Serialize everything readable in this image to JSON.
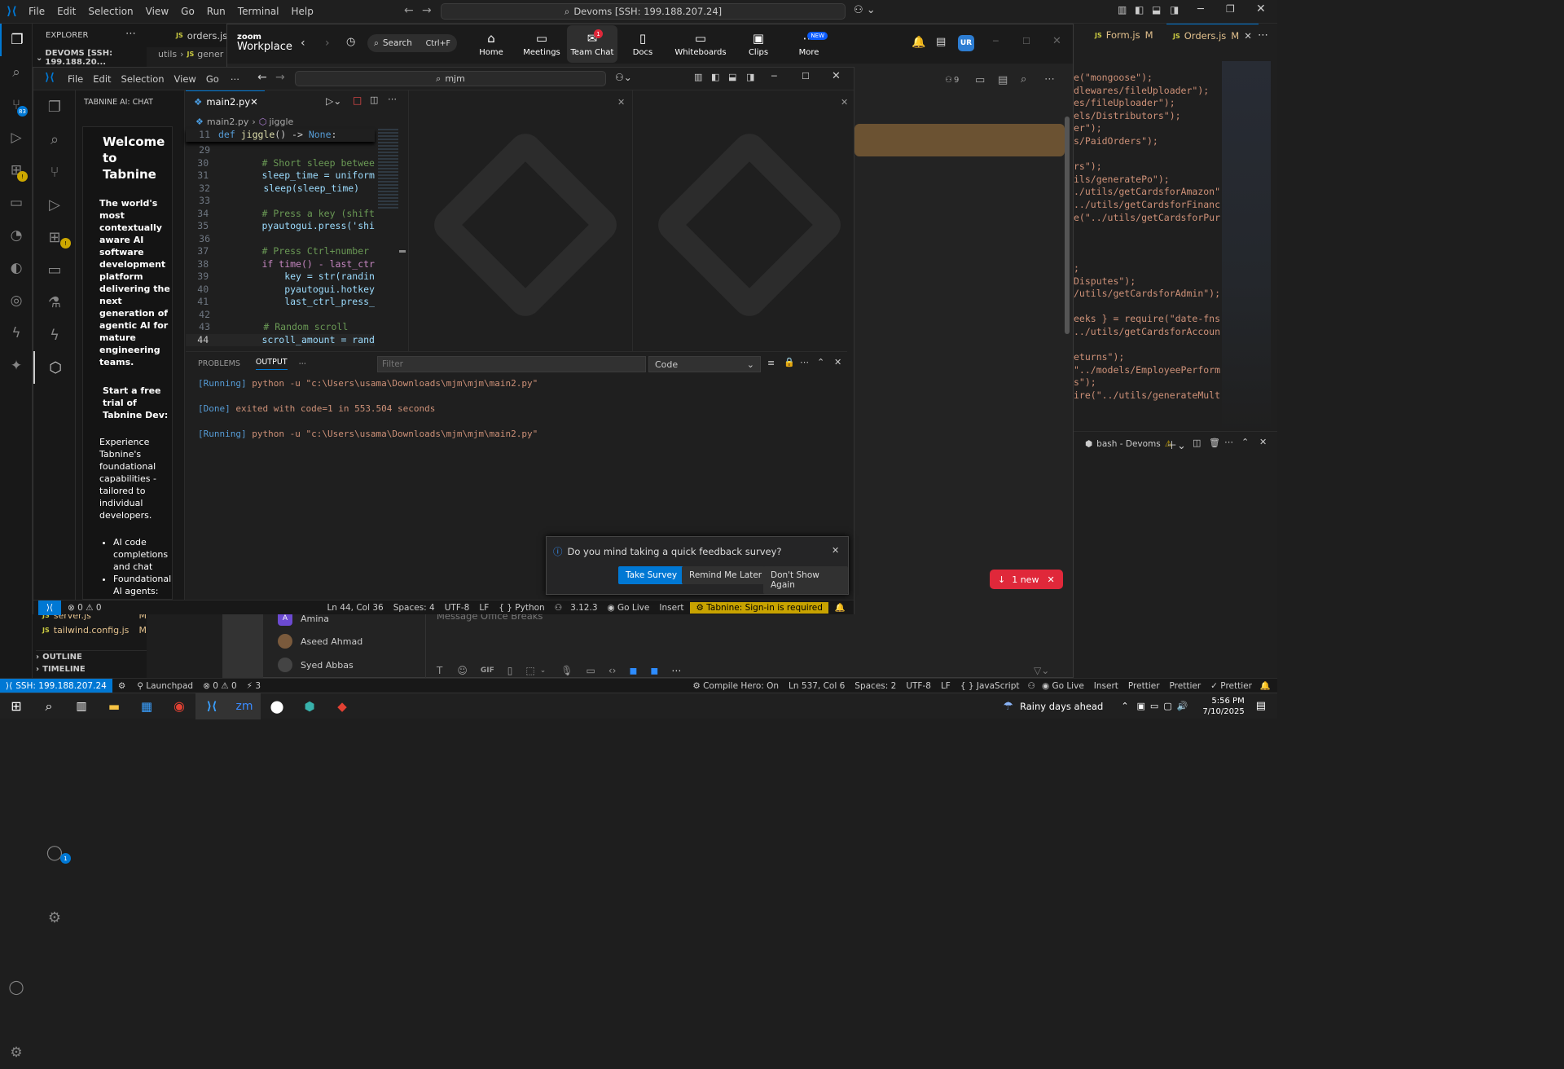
{
  "outer": {
    "menu": [
      "File",
      "Edit",
      "Selection",
      "View",
      "Go",
      "Run",
      "Terminal",
      "Help"
    ],
    "search": "Devoms [SSH: 199.188.207.24]",
    "explorer_label": "EXPLORER",
    "workspace": "DEVOMS [SSH: 199.188.20...",
    "source_control_badge": "83",
    "tabs": [
      {
        "label": "orders.js",
        "status": ""
      },
      {
        "label": "Form.js",
        "status": "M"
      },
      {
        "label": "Orders.js",
        "status": "M"
      }
    ],
    "breadcrumb": [
      "utils",
      "gener"
    ],
    "files": [
      {
        "name": "server.js",
        "status": "M"
      },
      {
        "name": "tailwind.config.js",
        "status": "M"
      }
    ],
    "outline_label": "OUTLINE",
    "timeline_label": "TIMELINE",
    "code_right": [
      "e(\"mongoose\");",
      "dlewares/fileUploader\");",
      "es/fileUploader\");",
      "els/Distributors\");",
      "er\");",
      "s/PaidOrders\");",
      "",
      "rs\");",
      "ils/generatePo\");",
      "./utils/getCardsforAmazon\");",
      "../utils/getCardsforFinance\");",
      "e(\"../utils/getCardsforPurcha",
      "",
      "",
      "",
      ";",
      "Disputes\");",
      "/utils/getCardsforAdmin\");",
      "",
      "eeks } = require(\"date-fns\");",
      "../utils/getCardsforAccount\")",
      "",
      "eturns\");",
      "\"../models/EmployeePerformanc",
      "s\");",
      "ire(\"../utils/generateMultipl"
    ],
    "terminal_label": "bash - Devoms",
    "status": {
      "remote": "SSH: 199.188.207.24",
      "launchpad": "Launchpad",
      "errors": "0",
      "warnings": "0",
      "ports": "3",
      "compile": "Compile Hero: On",
      "position": "Ln 537, Col 6",
      "spaces": "Spaces: 2",
      "encoding": "UTF-8",
      "eol": "LF",
      "language": "JavaScript",
      "golive": "Go Live",
      "insert": "Insert",
      "prettier1": "Prettier",
      "prettier2": "Prettier",
      "prettier3": "Prettier"
    }
  },
  "zoom": {
    "brand_top": "zoom",
    "brand_bottom": "Workplace",
    "search_label": "Search",
    "search_shortcut": "Ctrl+F",
    "nav": [
      {
        "label": "Home",
        "icon": "home-icon",
        "glyph": "⌂"
      },
      {
        "label": "Meetings",
        "icon": "video-icon",
        "glyph": "▭"
      },
      {
        "label": "Team Chat",
        "icon": "chat-icon",
        "glyph": "💬",
        "badge": "1"
      },
      {
        "label": "Docs",
        "icon": "doc-icon",
        "glyph": "▯"
      },
      {
        "label": "Whiteboards",
        "icon": "whiteboard-icon",
        "glyph": "▭"
      },
      {
        "label": "Clips",
        "icon": "clips-icon",
        "glyph": "▣"
      },
      {
        "label": "More",
        "icon": "more-icon",
        "glyph": "⋯",
        "new": "NEW"
      }
    ],
    "avatar": "UR",
    "members": "9",
    "contacts": [
      "Amina",
      "Aseed Ahmad",
      "Syed Abbas"
    ],
    "message_placeholder": "Message Office Breaks",
    "new_pill": "1 new"
  },
  "inner": {
    "menu": [
      "File",
      "Edit",
      "Selection",
      "View",
      "Go"
    ],
    "search": "mjm",
    "tabnine_title": "TABNINE AI: CHAT",
    "welcome": "Welcome to Tabnine",
    "intro": "The world's most contextually aware AI software development platform delivering the next generation of agentic AI for mature engineering teams.",
    "trial": "Start a free trial of Tabnine Dev:",
    "experience": "Experience Tabnine's foundational capabilities - tailored to individual developers.",
    "bullets": [
      "AI code completions and chat",
      "Foundational AI agents:"
    ],
    "accounts_badge": "1",
    "tab": "main2.py",
    "breadcrumb_file": "main2.py",
    "breadcrumb_fn": "jiggle",
    "sticky": {
      "num": "11",
      "code": "def jiggle() -> None:"
    },
    "code": [
      {
        "num": "29",
        "text": ""
      },
      {
        "num": "30",
        "text": "        # Short sleep betwee"
      },
      {
        "num": "31",
        "text": "        sleep_time = uniform"
      },
      {
        "num": "32",
        "text": "        sleep(sleep_time)"
      },
      {
        "num": "33",
        "text": ""
      },
      {
        "num": "34",
        "text": "        # Press a key (shift"
      },
      {
        "num": "35",
        "text": "        pyautogui.press('shi"
      },
      {
        "num": "36",
        "text": ""
      },
      {
        "num": "37",
        "text": "        # Press Ctrl+number "
      },
      {
        "num": "38",
        "text": "        if time() - last_ctr"
      },
      {
        "num": "39",
        "text": "            key = str(randin"
      },
      {
        "num": "40",
        "text": "            pyautogui.hotkey"
      },
      {
        "num": "41",
        "text": "            last_ctrl_press_"
      },
      {
        "num": "42",
        "text": ""
      },
      {
        "num": "43",
        "text": "        # Random scroll"
      },
      {
        "num": "44",
        "text": "        scroll_amount = rand"
      }
    ],
    "panel_tabs": [
      "PROBLEMS",
      "OUTPUT"
    ],
    "filter_placeholder": "Filter",
    "channel": "Code",
    "output": [
      {
        "tag": "[Running]",
        "text": " python -u \"c:\\Users\\usama\\Downloads\\mjm\\mjm\\main2.py\""
      },
      {
        "tag": "",
        "text": ""
      },
      {
        "tag": "[Done]",
        "text": " exited with code=1 in 553.504 seconds"
      },
      {
        "tag": "",
        "text": ""
      },
      {
        "tag": "[Running]",
        "text": " python -u \"c:\\Users\\usama\\Downloads\\mjm\\mjm\\main2.py\""
      }
    ],
    "survey": {
      "question": "Do you mind taking a quick feedback survey?",
      "take": "Take Survey",
      "later": "Remind Me Later",
      "never": "Don't Show Again"
    },
    "status": {
      "errors": "0",
      "warnings": "0",
      "position": "Ln 44, Col 36",
      "spaces": "Spaces: 4",
      "encoding": "UTF-8",
      "eol": "LF",
      "language": "Python",
      "version": "3.12.3",
      "golive": "Go Live",
      "insert": "Insert",
      "tabnine": "Tabnine: Sign-in is required"
    }
  },
  "taskbar": {
    "weather": "Rainy days ahead",
    "time": "5:56 PM",
    "date": "7/10/2025"
  },
  "colors": {
    "accent": "#0078d4",
    "tabnine_warn": "#cca700",
    "pill": "#e0283a"
  }
}
